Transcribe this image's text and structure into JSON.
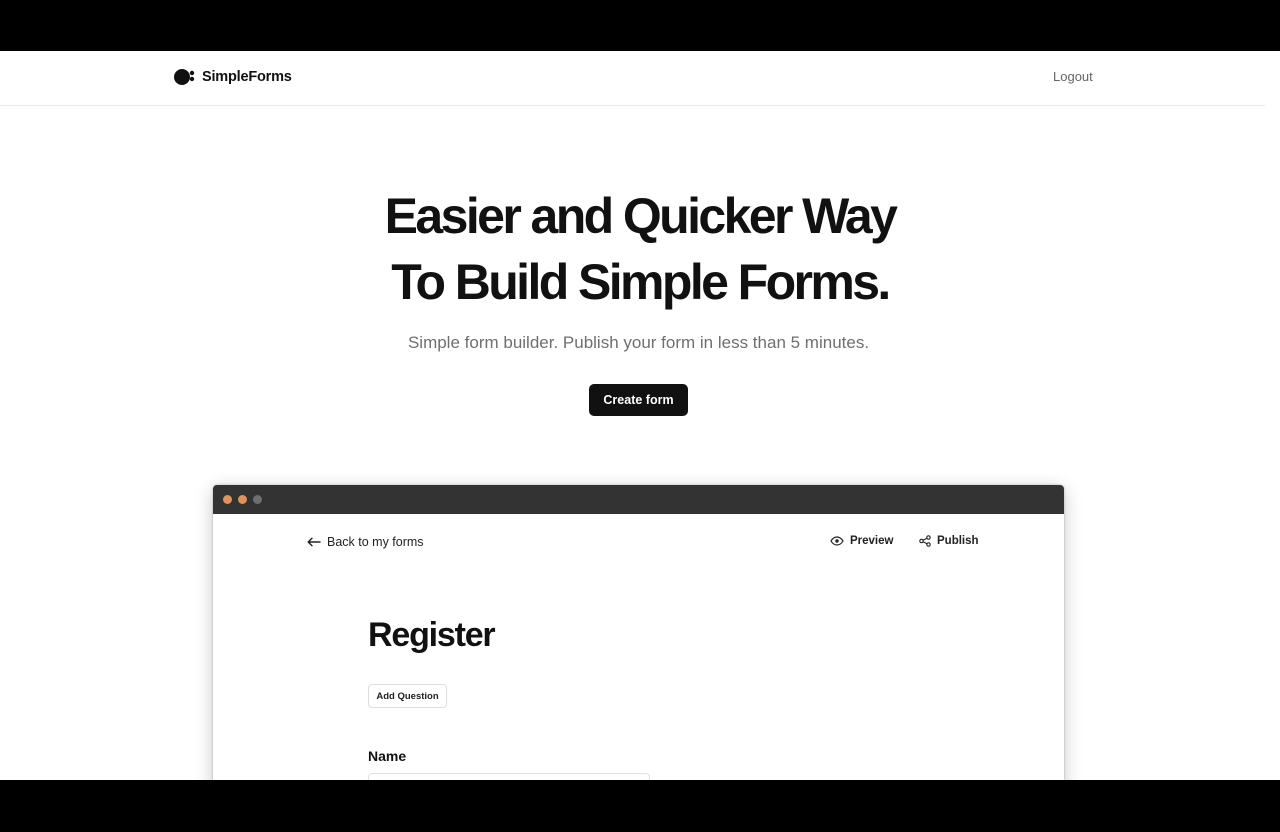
{
  "app": {
    "brand": "SimpleForms"
  },
  "header": {
    "logout_label": "Logout"
  },
  "hero": {
    "title_line1": "Easier and Quicker Way",
    "title_line2": "To Build Simple Forms.",
    "subtitle": "Simple form builder. Publish your form in less than 5 minutes.",
    "cta_label": "Create form"
  },
  "mock": {
    "back_label": "Back to my forms",
    "preview_label": "Preview",
    "publish_label": "Publish",
    "form_title": "Register",
    "add_question_label": "Add Question",
    "field_label": "Name",
    "window_dot_colors": [
      "#e0925a",
      "#e0925a",
      "#6f6f6f"
    ]
  },
  "icons": {
    "logo": "simpleforms-logo-icon",
    "back": "arrow-left-icon",
    "preview": "eye-icon",
    "publish": "share-icon"
  }
}
